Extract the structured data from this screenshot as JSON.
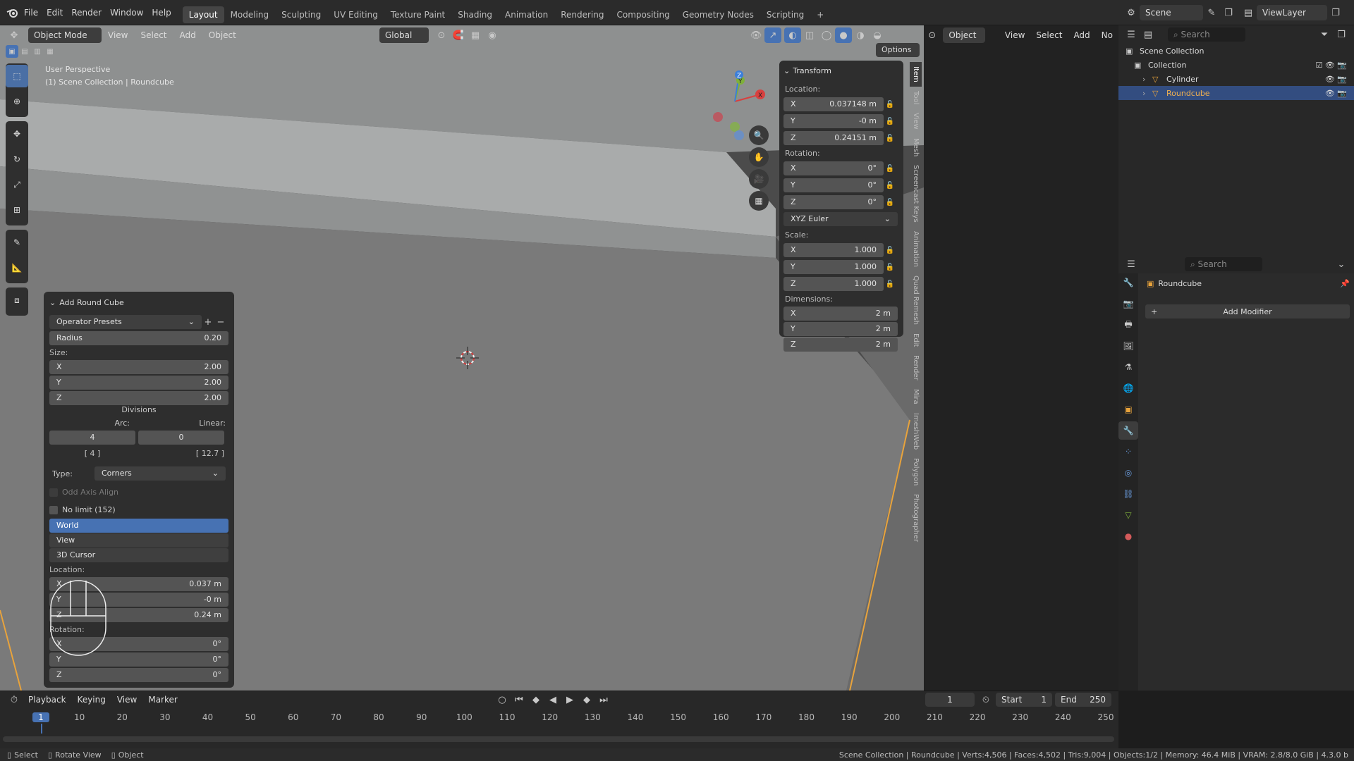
{
  "topbar": {
    "menus": [
      "File",
      "Edit",
      "Render",
      "Window",
      "Help"
    ],
    "workspaces": [
      "Layout",
      "Modeling",
      "Sculpting",
      "UV Editing",
      "Texture Paint",
      "Shading",
      "Animation",
      "Rendering",
      "Compositing",
      "Geometry Nodes",
      "Scripting"
    ],
    "active_workspace": "Layout",
    "add_tab": "+",
    "scene": "Scene",
    "view_layer": "ViewLayer"
  },
  "viewport": {
    "mode": "Object Mode",
    "menus": [
      "View",
      "Select",
      "Add",
      "Object"
    ],
    "orientation": "Global",
    "options_label": "Options",
    "overlay_line1": "User Perspective",
    "overlay_line2": "(1) Scene Collection | Roundcube"
  },
  "operator": {
    "title": "Add Round Cube",
    "presets": "Operator Presets",
    "radius_label": "Radius",
    "radius": "0.20",
    "size_label": "Size:",
    "size": [
      {
        "axis": "X",
        "value": "2.00"
      },
      {
        "axis": "Y",
        "value": "2.00"
      },
      {
        "axis": "Z",
        "value": "2.00"
      }
    ],
    "divisions_label": "Divisions",
    "arc_label": "Arc:",
    "linear_label": "Linear:",
    "arc": "4",
    "linear": "0",
    "arc_info": "[ 4 ]",
    "linear_info": "[ 12.7 ]",
    "type_label": "Type:",
    "type": "Corners",
    "odd_axis": "Odd Axis Align",
    "no_limit": "No limit (152)",
    "align": [
      "World",
      "View",
      "3D Cursor"
    ],
    "align_selected": "World",
    "location_label": "Location:",
    "location": [
      {
        "axis": "X",
        "value": "0.037 m"
      },
      {
        "axis": "Y",
        "value": "-0 m"
      },
      {
        "axis": "Z",
        "value": "0.24 m"
      }
    ],
    "rotation_label": "Rotation:",
    "rotation": [
      {
        "axis": "X",
        "value": "0°"
      },
      {
        "axis": "Y",
        "value": "0°"
      },
      {
        "axis": "Z",
        "value": "0°"
      }
    ]
  },
  "transform": {
    "title": "Transform",
    "location_label": "Location:",
    "location": [
      {
        "axis": "X",
        "value": "0.037148 m"
      },
      {
        "axis": "Y",
        "value": "-0 m"
      },
      {
        "axis": "Z",
        "value": "0.24151 m"
      }
    ],
    "rotation_label": "Rotation:",
    "rotation": [
      {
        "axis": "X",
        "value": "0°"
      },
      {
        "axis": "Y",
        "value": "0°"
      },
      {
        "axis": "Z",
        "value": "0°"
      }
    ],
    "rotation_mode": "XYZ Euler",
    "scale_label": "Scale:",
    "scale": [
      {
        "axis": "X",
        "value": "1.000"
      },
      {
        "axis": "Y",
        "value": "1.000"
      },
      {
        "axis": "Z",
        "value": "1.000"
      }
    ],
    "dimensions_label": "Dimensions:",
    "dimensions": [
      {
        "axis": "X",
        "value": "2 m"
      },
      {
        "axis": "Y",
        "value": "2 m"
      },
      {
        "axis": "Z",
        "value": "2 m"
      }
    ]
  },
  "sidebar_tabs": [
    "Item",
    "Tool",
    "View",
    "Mesh",
    "Screencast Keys",
    "Animation",
    "Quad Remesh",
    "Edit",
    "Render",
    "Mira",
    "ImeshWeb",
    "Polygon",
    "Photographer"
  ],
  "gizmo": {
    "x": "X",
    "y": "Y",
    "z": "Z"
  },
  "spreadsheet": {
    "mode": "Object",
    "menus": [
      "View",
      "Select",
      "Add",
      "No"
    ],
    "search_placeholder": "Search"
  },
  "outliner": {
    "search_placeholder": "Search",
    "items": [
      {
        "label": "Scene Collection",
        "level": 0
      },
      {
        "label": "Collection",
        "level": 1
      },
      {
        "label": "Cylinder",
        "level": 2
      },
      {
        "label": "Roundcube",
        "level": 2
      }
    ]
  },
  "properties": {
    "search_placeholder": "Search",
    "object": "Roundcube",
    "add_modifier": "Add Modifier"
  },
  "timeline": {
    "menus": [
      "Playback",
      "Keying",
      "View",
      "Marker"
    ],
    "current_frame": "1",
    "start_label": "Start",
    "start": "1",
    "end_label": "End",
    "end": "250",
    "ticks": [
      "1",
      "10",
      "20",
      "30",
      "40",
      "50",
      "60",
      "70",
      "80",
      "90",
      "100",
      "110",
      "120",
      "130",
      "140",
      "150",
      "160",
      "170",
      "180",
      "190",
      "200",
      "210",
      "220",
      "230",
      "240",
      "250"
    ]
  },
  "statusbar": {
    "select": "Select",
    "rotate": "Rotate View",
    "object": "Object",
    "info": "Scene Collection | Roundcube | Verts:4,506 | Faces:4,502 | Tris:9,004 | Objects:1/2 | Memory: 46.4 MiB | VRAM: 2.8/8.0 GiB | 4.3.0 b"
  },
  "colors": {
    "accent": "#4772b3",
    "object_orange": "#e8a33c",
    "axis_x": "#d8403f",
    "axis_y": "#7fb03a",
    "axis_z": "#3b7ed9"
  }
}
